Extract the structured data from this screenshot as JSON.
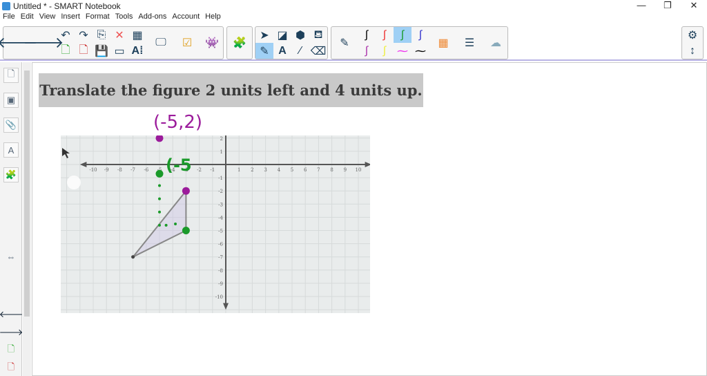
{
  "window": {
    "title": "Untitled * - SMART Notebook",
    "controls": [
      "—",
      "❐",
      "✕"
    ]
  },
  "menu": [
    "File",
    "Edit",
    "View",
    "Insert",
    "Format",
    "Tools",
    "Add-ons",
    "Account",
    "Help"
  ],
  "page": {
    "instruction": "Translate the figure 2 units left and 4 units up.",
    "annotations": [
      {
        "text": "(-5,2)",
        "color": "#9b1b9b"
      },
      {
        "text": "(-5",
        "color": "#1a9a2a"
      }
    ]
  },
  "colors": {
    "pen_selected": "#1a9a2a",
    "purple": "#9b1b9b",
    "green": "#1a9a2a"
  },
  "graph": {
    "x_ticks": [
      -10,
      -9,
      -8,
      -7,
      -6,
      -5,
      -4,
      -3,
      -2,
      -1,
      1,
      2,
      3,
      4,
      5,
      6,
      7,
      8,
      9,
      10
    ],
    "y_ticks": [
      2,
      1,
      -1,
      -2,
      -3,
      -4,
      -5,
      -6,
      -7,
      -8,
      -9,
      -10
    ],
    "triangle": [
      [
        -3,
        -2
      ],
      [
        -3,
        -5
      ],
      [
        -7,
        -7
      ]
    ],
    "purple_points": [
      [
        -5,
        2
      ],
      [
        -3,
        -2
      ]
    ],
    "green_points": [
      [
        -5,
        -0.7
      ],
      [
        -3,
        -5
      ]
    ],
    "green_dots": [
      [
        -5,
        -1.6
      ],
      [
        -5,
        -2.6
      ],
      [
        -5,
        -3.6
      ],
      [
        -5,
        -4.6
      ],
      [
        -4.5,
        -4.6
      ],
      [
        -3.8,
        -4.5
      ]
    ]
  }
}
